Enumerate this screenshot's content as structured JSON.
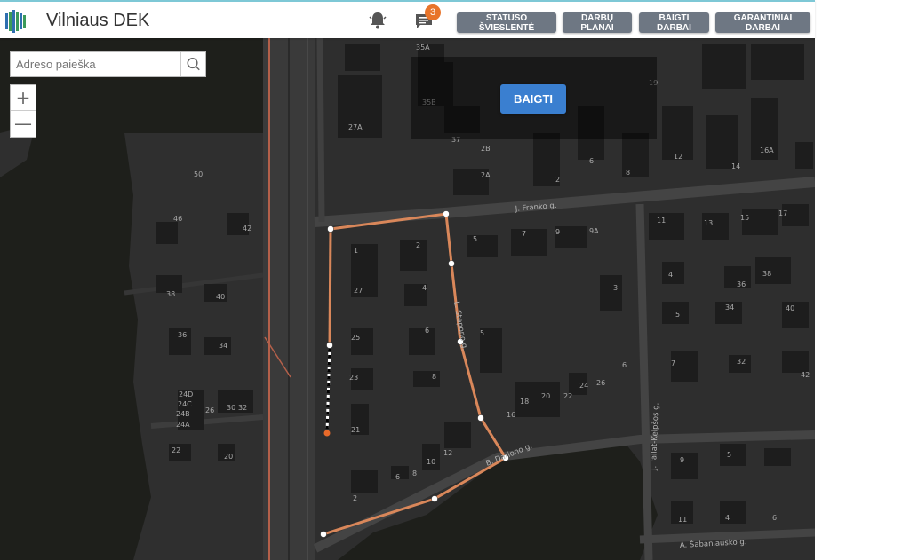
{
  "header": {
    "title": "Vilniaus DEK",
    "notification_count": "3",
    "buttons": [
      {
        "id": "statuso",
        "label": "STATUSO ŠVIESLENTĖ"
      },
      {
        "id": "planai",
        "label": "DARBŲ PLANAI"
      },
      {
        "id": "baigti",
        "label": "BAIGTI DARBAI"
      },
      {
        "id": "garantiniai",
        "label": "GARANTINIAI DARBAI"
      }
    ]
  },
  "search": {
    "placeholder": "Adreso paieška"
  },
  "zoom": {
    "in": "+",
    "out": "—"
  },
  "overlay": {
    "finish_label": "BAIGTI"
  },
  "map": {
    "streets": [
      "J. Franko g.",
      "L. Stepono g.",
      "B. Dariono g.",
      "J. Tallat-Kelpšos g.",
      "A. Šabaniausko g."
    ],
    "house_numbers": [
      "35A",
      "35B",
      "37",
      "2B",
      "2A",
      "27A",
      "19",
      "12",
      "14",
      "16A",
      "6",
      "8",
      "2",
      "11",
      "13",
      "15",
      "17",
      "50",
      "46",
      "42",
      "1",
      "2",
      "5",
      "7",
      "9",
      "9A",
      "27",
      "4",
      "38",
      "40",
      "36",
      "34",
      "25",
      "6",
      "5",
      "3",
      "36",
      "38",
      "34",
      "40",
      "5",
      "4",
      "7",
      "32",
      "42",
      "23",
      "8",
      "6",
      "24",
      "26",
      "20",
      "22",
      "18",
      "16",
      "24D",
      "24C",
      "24B",
      "24A",
      "26",
      "30",
      "32",
      "22",
      "20",
      "21",
      "10",
      "12",
      "6",
      "8",
      "2",
      "9",
      "5",
      "11",
      "4",
      "6"
    ]
  },
  "colors": {
    "map_bg": "#2c2c2c",
    "route": "#d9875a",
    "accent_button": "#3a7fd0",
    "header_button": "#6e7783",
    "badge": "#e8742a"
  }
}
